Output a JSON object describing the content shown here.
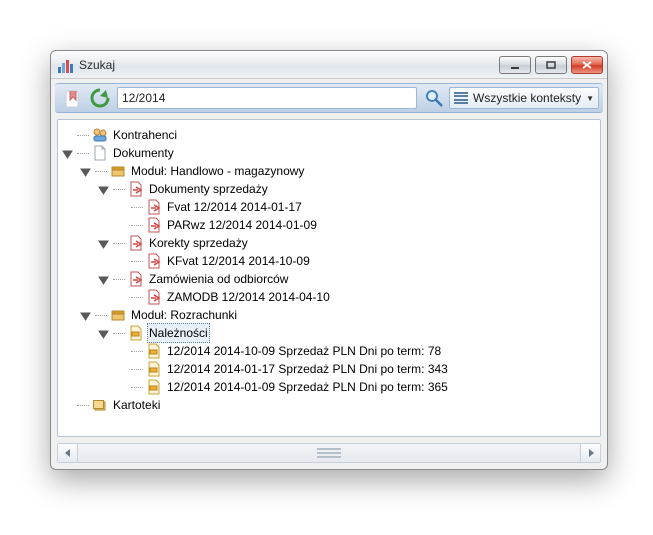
{
  "window": {
    "title": "Szukaj"
  },
  "toolbar": {
    "search_value": "12/2014",
    "context_label": "Wszystkie konteksty"
  },
  "tree": {
    "kontrahenci": "Kontrahenci",
    "dokumenty": "Dokumenty",
    "modul_hm": "Moduł: Handlowo - magazynowy",
    "dok_sprz": "Dokumenty sprzedaży",
    "fvat": "Fvat     12/2014  2014-01-17",
    "parwz": "PARwz 12/2014  2014-01-09",
    "kor_sprz": "Korekty sprzedaży",
    "kfvat": "KFvat 12/2014  2014-10-09",
    "zam_odb": "Zamówienia od odbiorców",
    "zamodb": "ZAMODB 12/2014  2014-04-10",
    "modul_rozr": "Moduł: Rozrachunki",
    "naleznosci": "Należności",
    "nal_1": "12/2014 2014-10-09 Sprzedaż PLN  Dni po term: 78",
    "nal_2": "12/2014 2014-01-17 Sprzedaż PLN  Dni po term: 343",
    "nal_3": "12/2014 2014-01-09 Sprzedaż PLN  Dni po term: 365",
    "kartoteki": "Kartoteki"
  }
}
